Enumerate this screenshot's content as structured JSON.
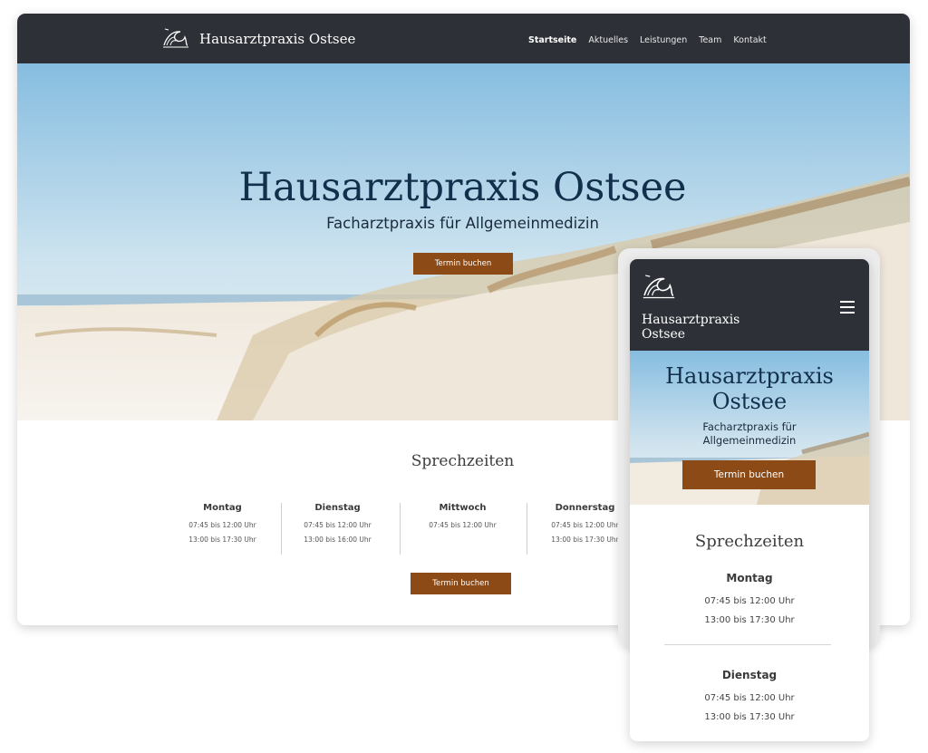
{
  "site": {
    "brand": "Hausarztpraxis Ostsee",
    "nav": [
      "Startseite",
      "Aktuelles",
      "Leistungen",
      "Team",
      "Kontakt"
    ],
    "active_nav": "Startseite"
  },
  "hero": {
    "title": "Hausarztpraxis Ostsee",
    "subtitle": "Facharztpraxis für Allgemeinmedizin",
    "cta": "Termin buchen"
  },
  "hours": {
    "title": "Sprechzeiten",
    "cta": "Termin buchen",
    "days": [
      {
        "name": "Montag",
        "times": [
          "07:45 bis 12:00 Uhr",
          "13:00 bis 17:30 Uhr"
        ]
      },
      {
        "name": "Dienstag",
        "times": [
          "07:45 bis 12:00 Uhr",
          "13:00 bis 16:00 Uhr"
        ]
      },
      {
        "name": "Mittwoch",
        "times": [
          "07:45 bis 12:00 Uhr"
        ]
      },
      {
        "name": "Donnerstag",
        "times": [
          "07:45 bis 12:00 Uhr",
          "13:00 bis 17:30 Uhr"
        ]
      }
    ]
  },
  "mobile": {
    "brand_line1": "Hausarztpraxis",
    "brand_line2": "Ostsee",
    "hero_title_line1": "Hausarztpraxis",
    "hero_title_line2": "Ostsee",
    "hero_sub_line1": "Facharztpraxis für",
    "hero_sub_line2": "Allgemeinmedizin",
    "cta": "Termin buchen",
    "hours_title": "Sprechzeiten",
    "days": [
      {
        "name": "Montag",
        "times": [
          "07:45 bis 12:00 Uhr",
          "13:00 bis 17:30 Uhr"
        ]
      },
      {
        "name": "Dienstag",
        "times": [
          "07:45 bis 12:00 Uhr",
          "13:00 bis 17:30 Uhr"
        ]
      }
    ]
  },
  "colors": {
    "nav_bg": "#2d3036",
    "accent_button": "#8b4a16",
    "hero_title": "#12304c"
  },
  "icons": {
    "logo": "wave-logo-icon",
    "menu": "hamburger-menu-icon"
  }
}
